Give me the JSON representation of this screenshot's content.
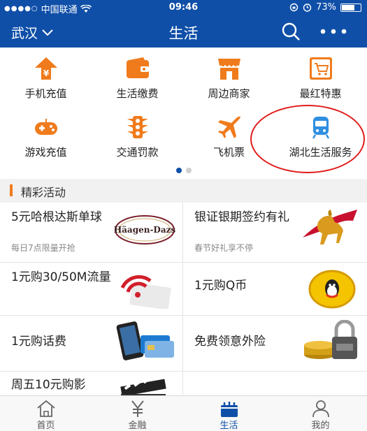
{
  "status_bar": {
    "carrier": "中国联通",
    "time": "09:46",
    "battery": "73%",
    "battery_level": 0.73
  },
  "nav": {
    "city": "武汉",
    "title": "生活"
  },
  "services": [
    {
      "label": "手机充值",
      "icon": "phone-recharge-icon"
    },
    {
      "label": "生活缴费",
      "icon": "wallet-icon"
    },
    {
      "label": "周边商家",
      "icon": "shop-icon"
    },
    {
      "label": "最红特惠",
      "icon": "shopping-cart-icon"
    },
    {
      "label": "游戏充值",
      "icon": "gamepad-icon"
    },
    {
      "label": "交通罚款",
      "icon": "traffic-light-icon"
    },
    {
      "label": "飞机票",
      "icon": "airplane-icon"
    },
    {
      "label": "湖北生活服务",
      "icon": "train-icon"
    }
  ],
  "pager": {
    "pages": 2,
    "current": 1
  },
  "section": {
    "title": "精彩活动"
  },
  "promotions": [
    {
      "title": "5元哈根达斯单球",
      "subtitle": "每日7点限量开抢",
      "image": "haagen-dazs-logo"
    },
    {
      "title": "银证银期签约有礼",
      "subtitle": "春节好礼享不停",
      "image": "golden-horse-image"
    },
    {
      "title": "1元购30/50M流量",
      "subtitle": "",
      "image": "wifi-signal-image"
    },
    {
      "title": "1元购Q币",
      "subtitle": "",
      "image": "qq-coin-image"
    },
    {
      "title": "1元购话费",
      "subtitle": "",
      "image": "phone-and-cards-image"
    },
    {
      "title": "免费领意外险",
      "subtitle": "",
      "image": "padlock-coins-image"
    },
    {
      "title": "周五10元购影",
      "subtitle": "",
      "image": "film-clapper-image"
    }
  ],
  "tabs": [
    {
      "label": "首页",
      "icon": "home-icon"
    },
    {
      "label": "金融",
      "icon": "yuan-icon"
    },
    {
      "label": "生活",
      "icon": "life-bag-icon",
      "active": true
    },
    {
      "label": "我的",
      "icon": "profile-icon"
    }
  ],
  "colors": {
    "brand_blue": "#0f4fa8",
    "icon_orange": "#f07b1c",
    "icon_blue": "#2f8fe0",
    "highlight_red": "#e01c1c"
  }
}
